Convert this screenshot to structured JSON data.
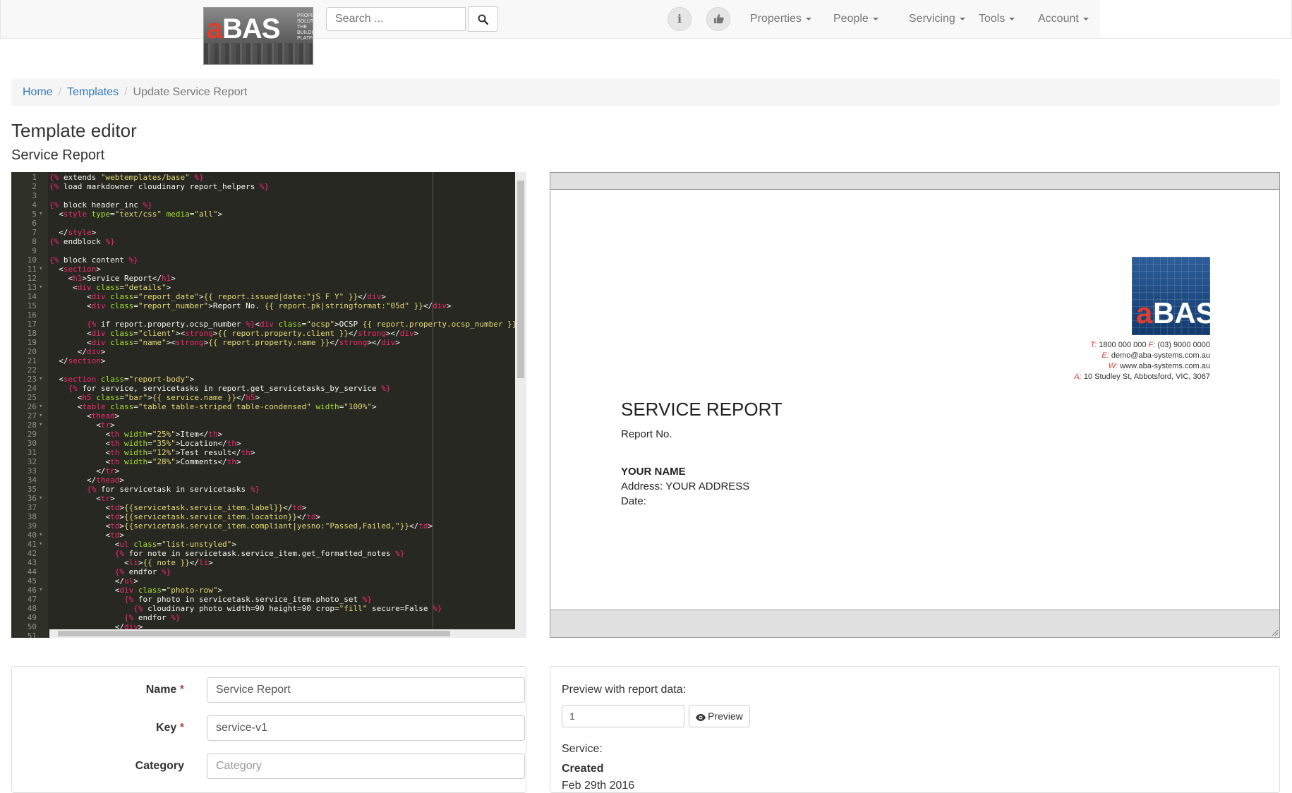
{
  "navbar": {
    "logo": {
      "letter_a": "a",
      "letters_bas": "BAS",
      "tagline": [
        "PROPERTY",
        "SOLUTIONS",
        "THE BUILDING",
        "PLATFORM"
      ]
    },
    "search_placeholder": "Search ...",
    "info_icon": "i",
    "menus": [
      "Properties",
      "People",
      "Servicing",
      "Tools",
      "Account"
    ]
  },
  "breadcrumb": {
    "home": "Home",
    "templates": "Templates",
    "current": "Update Service Report"
  },
  "page_title": "Template editor",
  "page_subtitle": "Service Report",
  "editor": {
    "lines": [
      {
        "n": "1",
        "f": "",
        "h": "<span class='k'>{%</span> extends <span class='s'>\"webtemplates/base\"</span> <span class='k'>%}</span>"
      },
      {
        "n": "2",
        "f": "",
        "h": "<span class='k'>{%</span> load markdowner cloudinary report_helpers <span class='k'>%}</span>"
      },
      {
        "n": "3",
        "f": "",
        "h": ""
      },
      {
        "n": "4",
        "f": "",
        "h": "<span class='k'>{%</span> block header_inc <span class='k'>%}</span>"
      },
      {
        "n": "5",
        "f": "▾",
        "h": "  &lt;<span class='k'>style</span> <span class='a'>type</span>=<span class='s'>\"text/css\"</span> <span class='a'>media</span>=<span class='s'>\"all\"</span>&gt;"
      },
      {
        "n": "6",
        "f": "",
        "h": ""
      },
      {
        "n": "7",
        "f": "",
        "h": "  &lt;/<span class='k'>style</span>&gt;"
      },
      {
        "n": "8",
        "f": "",
        "h": "<span class='k'>{%</span> endblock <span class='k'>%}</span>"
      },
      {
        "n": "9",
        "f": "",
        "h": ""
      },
      {
        "n": "10",
        "f": "",
        "h": "<span class='k'>{%</span> block content <span class='k'>%}</span>"
      },
      {
        "n": "11",
        "f": "▾",
        "h": "  &lt;<span class='k'>section</span>&gt;"
      },
      {
        "n": "12",
        "f": "",
        "h": "    &lt;<span class='k'>h1</span>&gt;Service Report&lt;/<span class='k'>h1</span>&gt;"
      },
      {
        "n": "13",
        "f": "▾",
        "h": "     &lt;<span class='k'>div</span> <span class='a'>class</span>=<span class='s'>\"details\"</span>&gt;"
      },
      {
        "n": "14",
        "f": "",
        "h": "        &lt;<span class='k'>div</span> <span class='a'>class</span>=<span class='s'>\"report_date\"</span>&gt;<span class='s'>{{ report.issued|date:\"jS F Y\" }}</span>&lt;/<span class='k'>div</span>&gt;"
      },
      {
        "n": "15",
        "f": "",
        "h": "        &lt;<span class='k'>div</span> <span class='a'>class</span>=<span class='s'>\"report_number\"</span>&gt;Report No. <span class='s'>{{ report.pk|stringformat:\"05d\" }}</span>&lt;/<span class='k'>div</span>&gt;"
      },
      {
        "n": "16",
        "f": "",
        "h": ""
      },
      {
        "n": "17",
        "f": "",
        "h": "        <span class='k'>{%</span> if report.property.ocsp_number <span class='k'>%}</span>&lt;<span class='k'>div</span> <span class='a'>class</span>=<span class='s'>\"ocsp\"</span>&gt;OCSP <span class='s'>{{ report.property.ocsp_number }}</span>-"
      },
      {
        "n": "18",
        "f": "",
        "h": "        &lt;<span class='k'>div</span> <span class='a'>class</span>=<span class='s'>\"client\"</span>&gt;&lt;<span class='k'>strong</span>&gt;<span class='s'>{{ report.property.client }}</span>&lt;/<span class='k'>strong</span>&gt;&lt;/<span class='k'>div</span>&gt;"
      },
      {
        "n": "19",
        "f": "",
        "h": "        &lt;<span class='k'>div</span> <span class='a'>class</span>=<span class='s'>\"name\"</span>&gt;&lt;<span class='k'>strong</span>&gt;<span class='s'>{{ report.property.name }}</span>&lt;/<span class='k'>strong</span>&gt;&lt;/<span class='k'>div</span>&gt;"
      },
      {
        "n": "20",
        "f": "",
        "h": "      &lt;/<span class='k'>div</span>&gt;"
      },
      {
        "n": "21",
        "f": "",
        "h": "  &lt;/<span class='k'>section</span>&gt;"
      },
      {
        "n": "22",
        "f": "",
        "h": ""
      },
      {
        "n": "23",
        "f": "▾",
        "h": "  &lt;<span class='k'>section</span> <span class='a'>class</span>=<span class='s'>\"report-body\"</span>&gt;"
      },
      {
        "n": "24",
        "f": "",
        "h": "    <span class='k'>{%</span> for service, servicetasks in report.get_servicetasks_by_service <span class='k'>%}</span>"
      },
      {
        "n": "25",
        "f": "",
        "h": "      &lt;<span class='k'>h5</span> <span class='a'>class</span>=<span class='s'>\"bar\"</span>&gt;<span class='s'>{{ service.name }}</span>&lt;/<span class='k'>h5</span>&gt;"
      },
      {
        "n": "26",
        "f": "▾",
        "h": "      &lt;<span class='k'>table</span> <span class='a'>class</span>=<span class='s'>\"table table-striped table-condensed\"</span> <span class='a'>width</span>=<span class='s'>\"100%\"</span>&gt;"
      },
      {
        "n": "27",
        "f": "▾",
        "h": "        &lt;<span class='k'>thead</span>&gt;"
      },
      {
        "n": "28",
        "f": "▾",
        "h": "          &lt;<span class='k'>tr</span>&gt;"
      },
      {
        "n": "29",
        "f": "",
        "h": "            &lt;<span class='k'>th</span> <span class='a'>width</span>=<span class='s'>\"25%\"</span>&gt;Item&lt;/<span class='k'>th</span>&gt;"
      },
      {
        "n": "30",
        "f": "",
        "h": "            &lt;<span class='k'>th</span> <span class='a'>width</span>=<span class='s'>\"35%\"</span>&gt;Location&lt;/<span class='k'>th</span>&gt;"
      },
      {
        "n": "31",
        "f": "",
        "h": "            &lt;<span class='k'>th</span> <span class='a'>width</span>=<span class='s'>\"12%\"</span>&gt;Test result&lt;/<span class='k'>th</span>&gt;"
      },
      {
        "n": "32",
        "f": "",
        "h": "            &lt;<span class='k'>th</span> <span class='a'>width</span>=<span class='s'>\"28%\"</span>&gt;Comments&lt;/<span class='k'>th</span>&gt;"
      },
      {
        "n": "33",
        "f": "",
        "h": "          &lt;/<span class='k'>tr</span>&gt;"
      },
      {
        "n": "34",
        "f": "",
        "h": "        &lt;/<span class='k'>thead</span>&gt;"
      },
      {
        "n": "35",
        "f": "",
        "h": "        <span class='k'>{%</span> for servicetask in servicetasks <span class='k'>%}</span>"
      },
      {
        "n": "36",
        "f": "▾",
        "h": "          &lt;<span class='k'>tr</span>&gt;"
      },
      {
        "n": "37",
        "f": "",
        "h": "            &lt;<span class='k'>td</span>&gt;<span class='s'>{{servicetask.service_item.label}}</span>&lt;/<span class='k'>td</span>&gt;"
      },
      {
        "n": "38",
        "f": "",
        "h": "            &lt;<span class='k'>td</span>&gt;<span class='s'>{{servicetask.service_item.location}}</span>&lt;/<span class='k'>td</span>&gt;"
      },
      {
        "n": "39",
        "f": "",
        "h": "            &lt;<span class='k'>td</span>&gt;<span class='s'>{{servicetask.service_item.compliant|yesno:\"Passed,Failed,\"}}</span>&lt;/<span class='k'>td</span>&gt;"
      },
      {
        "n": "40",
        "f": "▾",
        "h": "            &lt;<span class='k'>td</span>&gt;"
      },
      {
        "n": "41",
        "f": "▾",
        "h": "              &lt;<span class='k'>ul</span> <span class='a'>class</span>=<span class='s'>\"list-unstyled\"</span>&gt;"
      },
      {
        "n": "42",
        "f": "",
        "h": "              <span class='k'>{%</span> for note in servicetask.service_item.get_formatted_notes <span class='k'>%}</span>"
      },
      {
        "n": "43",
        "f": "",
        "h": "                &lt;<span class='k'>li</span>&gt;<span class='s'>{{ note }}</span>&lt;/<span class='k'>li</span>&gt;"
      },
      {
        "n": "44",
        "f": "",
        "h": "              <span class='k'>{%</span> endfor <span class='k'>%}</span>"
      },
      {
        "n": "45",
        "f": "",
        "h": "              &lt;/<span class='k'>ul</span>&gt;"
      },
      {
        "n": "46",
        "f": "▾",
        "h": "              &lt;<span class='k'>div</span> <span class='a'>class</span>=<span class='s'>\"photo-row\"</span>&gt;"
      },
      {
        "n": "47",
        "f": "",
        "h": "                <span class='k'>{%</span> for photo in servicetask.service_item.photo_set <span class='k'>%}</span>"
      },
      {
        "n": "48",
        "f": "",
        "h": "                  <span class='k'>{%</span> cloudinary photo width=90 height=90 crop=<span class='s'>\"fill\"</span> secure=False <span class='k'>%}</span>"
      },
      {
        "n": "49",
        "f": "",
        "h": "                <span class='k'>{%</span> endfor <span class='k'>%}</span>"
      },
      {
        "n": "50",
        "f": "",
        "h": "              &lt;/<span class='k'>div</span>&gt;"
      },
      {
        "n": "51",
        "f": "",
        "h": ""
      }
    ]
  },
  "report_preview": {
    "logo": {
      "letter_a": "a",
      "letters_bas": "BAS"
    },
    "contact": [
      {
        "text": "T: 1800 000 000 F: (03) 9000 0000"
      },
      {
        "text": "E: demo@aba-systems.com.au"
      },
      {
        "text": "W: www.aba-systems.com.au"
      },
      {
        "text": "A: 10 Studley St, Abbotsford, VIC, 3067"
      }
    ],
    "title": "SERVICE REPORT",
    "report_no": "Report No.",
    "your_name": "YOUR NAME",
    "address": "Address: YOUR ADDRESS",
    "date": "Date:"
  },
  "form": {
    "name_label": "Name",
    "name_value": "Service Report",
    "key_label": "Key",
    "key_value": "service-v1",
    "category_label": "Category",
    "category_placeholder": "Category",
    "required_marker": "*"
  },
  "preview_panel": {
    "label": "Preview with report data:",
    "input_value": "1",
    "button_label": "Preview",
    "service_label": "Service:",
    "created_label": "Created",
    "created_value": "Feb 29th 2016"
  }
}
